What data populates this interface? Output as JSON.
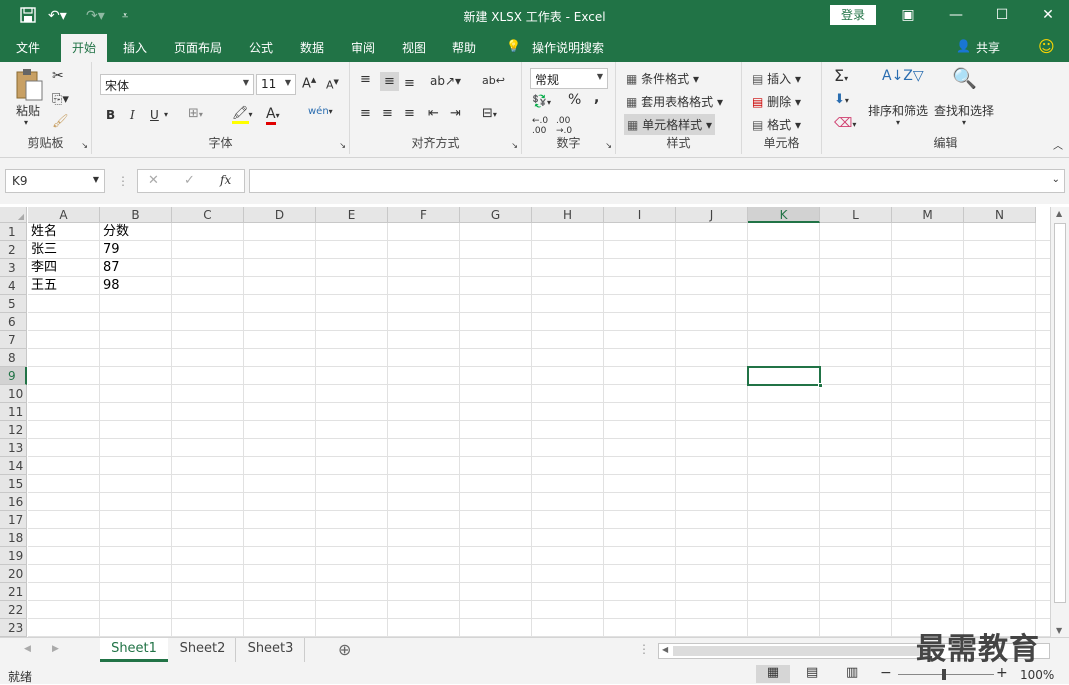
{
  "titlebar": {
    "title": "新建 XLSX 工作表  -  Excel",
    "login": "登录",
    "undo_icon": "undo-icon",
    "redo_icon": "redo-icon",
    "save_icon": "save-icon"
  },
  "tabs": [
    "文件",
    "开始",
    "插入",
    "页面布局",
    "公式",
    "数据",
    "审阅",
    "视图",
    "帮助",
    "操作说明搜索"
  ],
  "active_tab": "开始",
  "share": "共享",
  "ribbon": {
    "clipboard": {
      "paste": "粘贴",
      "label": "剪贴板"
    },
    "font": {
      "name": "宋体",
      "size": "11",
      "bold": "B",
      "italic": "I",
      "underline": "U",
      "label": "字体"
    },
    "alignment": {
      "label": "对齐方式"
    },
    "number": {
      "format": "常规",
      "label": "数字",
      "percent": "%",
      "comma": ","
    },
    "styles": {
      "conditional": "条件格式",
      "table": "套用表格格式",
      "cell": "单元格样式",
      "label": "样式"
    },
    "cells": {
      "insert": "插入",
      "delete": "删除",
      "format": "格式",
      "label": "单元格"
    },
    "editing": {
      "sort": "排序和筛选",
      "find": "查找和选择",
      "label": "编辑"
    }
  },
  "formula_bar": {
    "name_box": "K9",
    "fx": "fx",
    "content": ""
  },
  "columns": [
    "A",
    "B",
    "C",
    "D",
    "E",
    "F",
    "G",
    "H",
    "I",
    "J",
    "K",
    "L",
    "M",
    "N"
  ],
  "rows": [
    "1",
    "2",
    "3",
    "4",
    "5",
    "6",
    "7",
    "8",
    "9",
    "10",
    "11",
    "12",
    "13",
    "14",
    "15",
    "16",
    "17",
    "18",
    "19",
    "20",
    "21",
    "22",
    "23"
  ],
  "cells": [
    [
      "姓名",
      "分数"
    ],
    [
      "张三",
      "79"
    ],
    [
      "李四",
      "87"
    ],
    [
      "王五",
      "98"
    ]
  ],
  "selected_cell": "K9",
  "sheets": [
    "Sheet1",
    "Sheet2",
    "Sheet3"
  ],
  "active_sheet": "Sheet1",
  "status": {
    "ready": "就绪",
    "zoom": "100%"
  },
  "watermark": "最需教育",
  "accent": "#217346"
}
